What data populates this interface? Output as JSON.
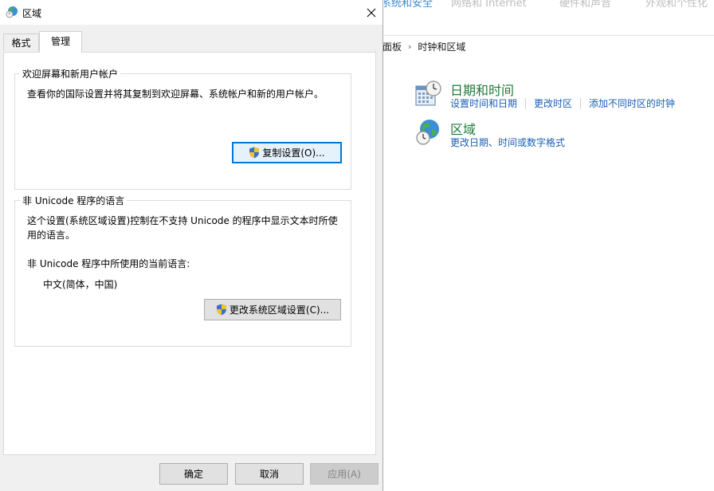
{
  "dialog": {
    "title": "区域",
    "tabs": [
      {
        "label": "格式"
      },
      {
        "label": "管理"
      }
    ],
    "welcome_group": {
      "title": "欢迎屏幕和新用户帐户",
      "description": "查看你的国际设置并将其复制到欢迎屏幕、系统帐户和新的用户帐户。",
      "copy_button": "复制设置(O)..."
    },
    "unicode_group": {
      "title": "非 Unicode 程序的语言",
      "description_line1": "这个设置(系统区域设置)控制在不支持 Unicode 的程序中显示文本时所使",
      "description_line2": "用的语言。",
      "current_label": "非 Unicode 程序中所使用的当前语言:",
      "current_value": "中文(简体，中国)",
      "change_button": "更改系统区域设置(C)..."
    },
    "footer": {
      "ok": "确定",
      "cancel": "取消",
      "apply": "应用(A)"
    }
  },
  "control_panel": {
    "breadcrumb": [
      "面板",
      "时钟和区域"
    ],
    "items": [
      {
        "title": "日期和时间",
        "links": [
          "设置时间和日期",
          "更改时区",
          "添加不同时区的时钟"
        ]
      },
      {
        "title": "区域",
        "links": [
          "更改日期、时间或数字格式"
        ]
      }
    ]
  },
  "colors": {
    "accent": "#0078d7",
    "link": "#1a5fb4",
    "cp_title": "#1e7a3a"
  }
}
